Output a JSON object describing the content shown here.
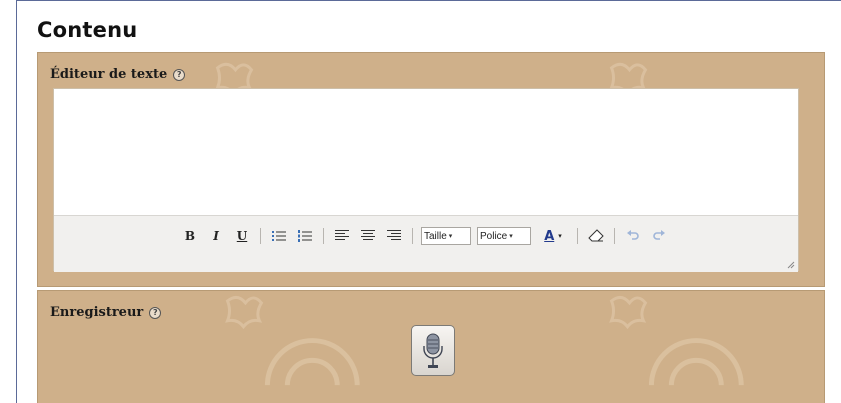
{
  "section": {
    "title": "Contenu"
  },
  "editor": {
    "label": "Éditeur de texte",
    "help_icon_glyph": "?",
    "content": "",
    "toolbar": {
      "bold": "B",
      "italic": "I",
      "underline": "U",
      "size_select": "Taille ",
      "font_select": "Police",
      "font_color": "A"
    },
    "icons": [
      "bold-icon",
      "italic-icon",
      "underline-icon",
      "bullet-list-icon",
      "numbered-list-icon",
      "align-left-icon",
      "align-center-icon",
      "align-right-icon",
      "font-color-icon",
      "eraser-icon",
      "undo-icon",
      "redo-icon",
      "resize-grip-icon"
    ]
  },
  "recorder": {
    "label": "Enregistreur",
    "help_icon_glyph": "?",
    "icons": [
      "microphone-icon"
    ]
  },
  "colors": {
    "panel_bg": "#cfb08a",
    "frame_border": "#5b6a98",
    "toolbar_bg": "#f1f0ee"
  }
}
